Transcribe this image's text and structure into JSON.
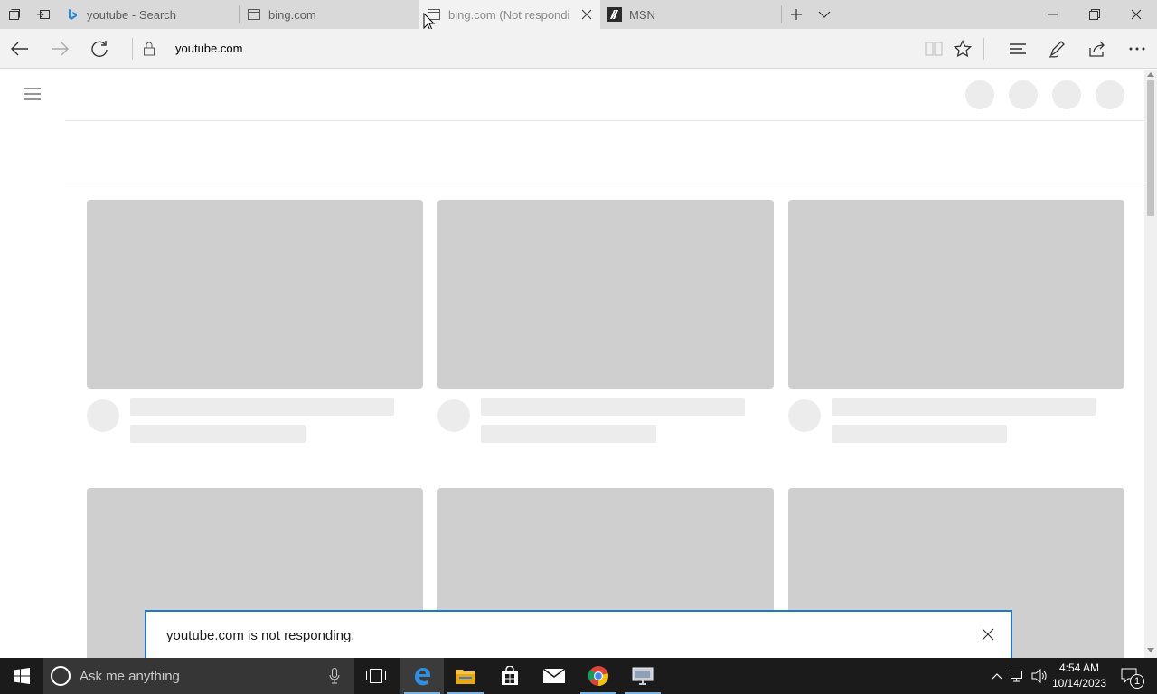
{
  "browser": {
    "tabs": [
      {
        "title": "youtube - Search",
        "favicon": "bing-icon",
        "active": false
      },
      {
        "title": "bing.com",
        "favicon": "page-icon",
        "active": false
      },
      {
        "title": "bing.com (Not respondi",
        "favicon": "page-icon",
        "active": true
      },
      {
        "title": "MSN",
        "favicon": "msn-icon",
        "active": false
      }
    ],
    "address": {
      "url": "youtube.com"
    }
  },
  "notification": {
    "message": "youtube.com is not responding."
  },
  "taskbar": {
    "search_placeholder": "Ask me anything",
    "time": "4:54 AM",
    "date": "10/14/2023",
    "notification_count": "1"
  },
  "colors": {
    "accent": "#1e7ac7",
    "placeholder_dark": "#cfcfcf",
    "placeholder_light": "#ececec",
    "tabbar": "#d9d9d9",
    "taskbar": "#1b1b1b"
  }
}
